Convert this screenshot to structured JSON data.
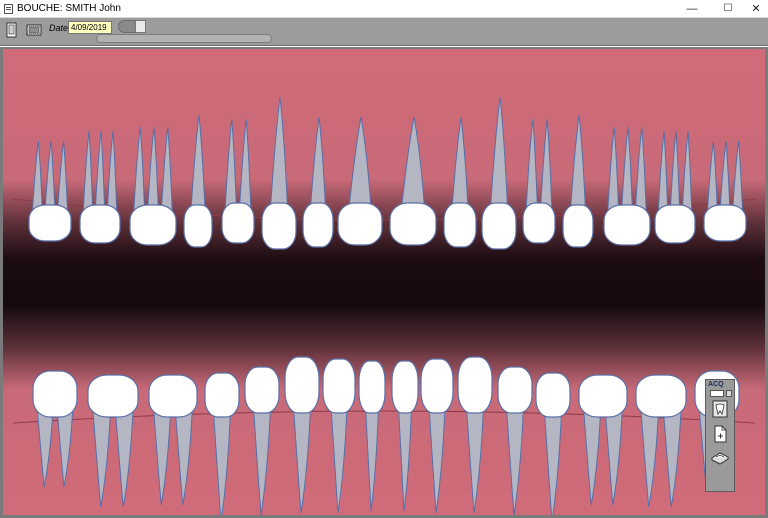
{
  "window": {
    "title": "BOUCHE: SMITH John",
    "minimize_label": "—",
    "maximize_label": "☐",
    "close_label": "✕"
  },
  "toolbar": {
    "chart_icon": "dental-chart-icon",
    "xray_icon": "film-icon",
    "date_label": "Date",
    "date_value": "4/09/2019",
    "toggle_state": "on",
    "progress_percent": 0
  },
  "side_panel": {
    "title": "ACQ",
    "buttons": [
      {
        "icon": "tooth-xray-icon"
      },
      {
        "icon": "document-add-icon"
      },
      {
        "icon": "scanner-icon"
      }
    ]
  },
  "colors": {
    "gum": "#d16b79",
    "mouth_dark": "#17080d",
    "tooth_root": "#b4b6c4",
    "tooth_outline": "#5a6fa6",
    "crown": "#ffffff",
    "toolbar": "#9c9c9c",
    "date_field": "#ffffc0"
  }
}
